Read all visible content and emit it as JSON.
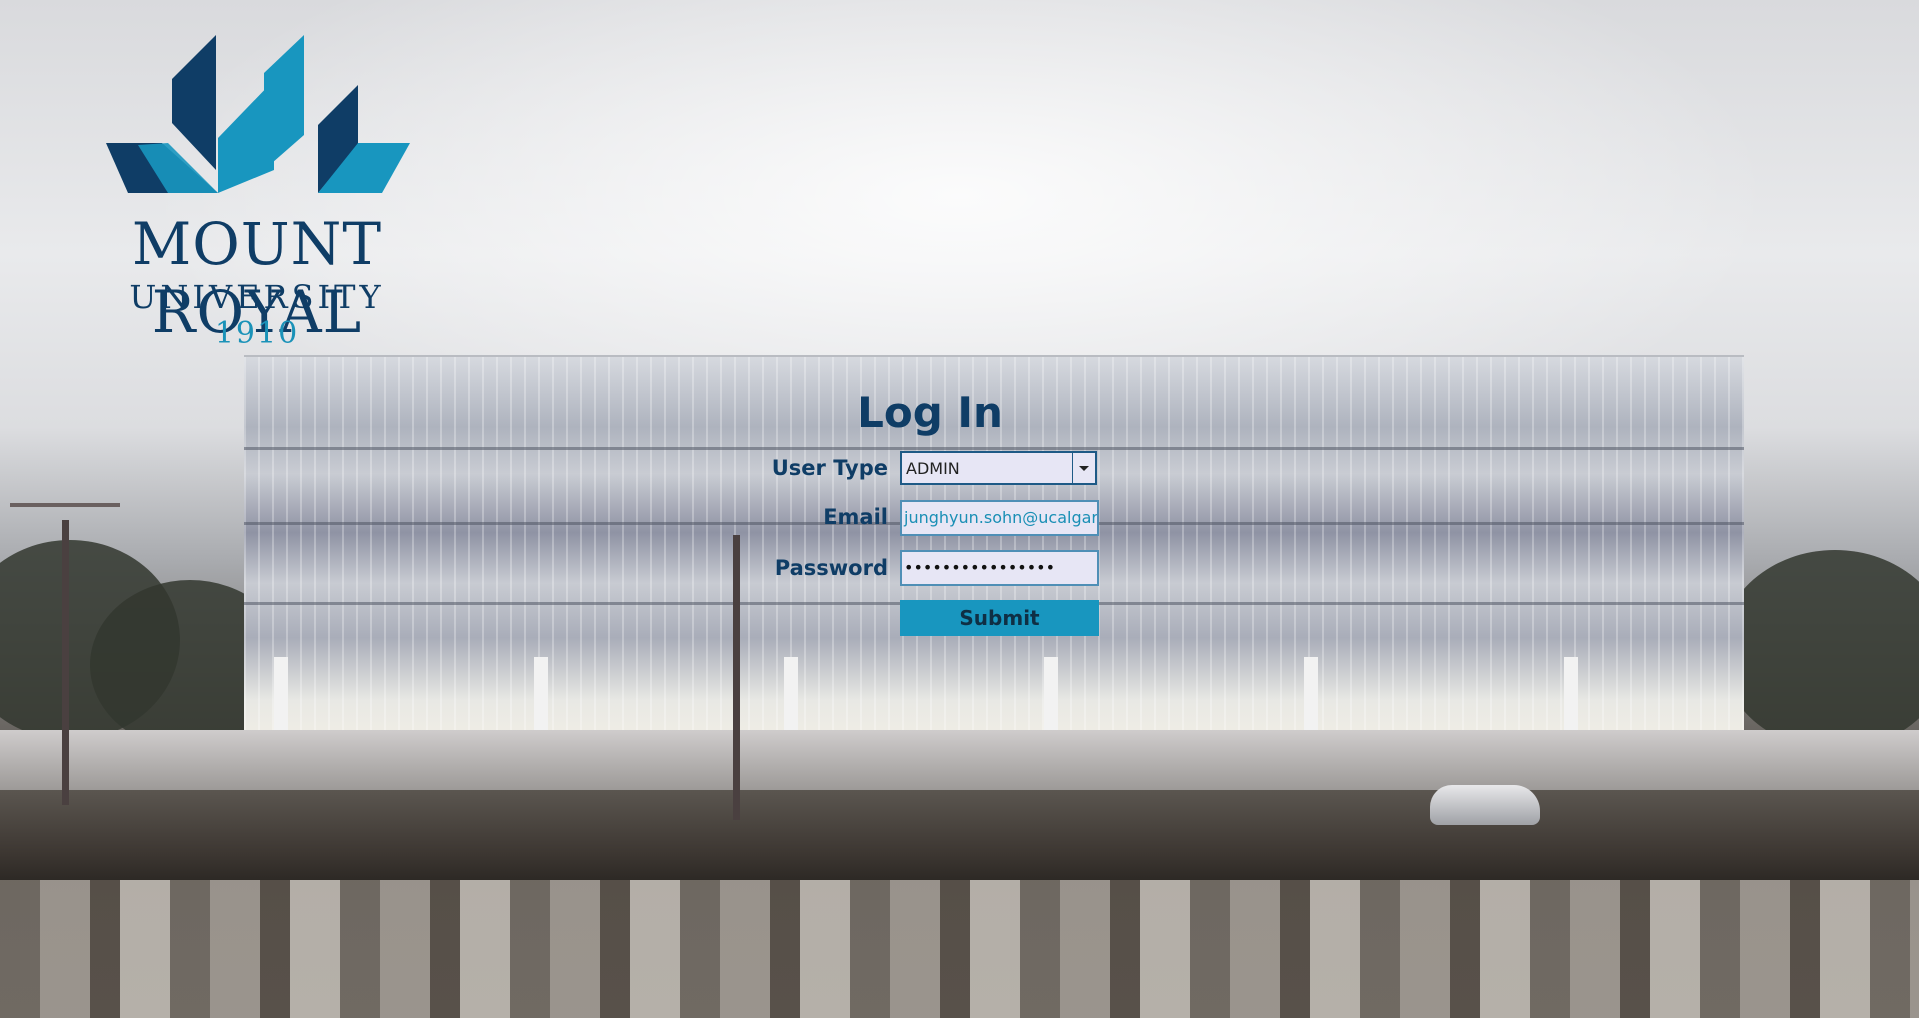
{
  "logo": {
    "title": "MOUNT ROYAL",
    "subtitle": "UNIVERSITY",
    "year": "1910",
    "colors": {
      "dark_blue": "#0f3d66",
      "light_blue": "#1a92b8"
    }
  },
  "login": {
    "title": "Log In",
    "user_type_label": "User Type",
    "user_type_value": "ADMIN",
    "email_label": "Email",
    "email_value": "junghyun.sohn@ucalgary",
    "password_label": "Password",
    "password_value": "••••••••••••••••",
    "submit_label": "Submit",
    "colors": {
      "submit_bg": "#1896bf",
      "field_bg": "#e7e6f5",
      "label": "#0f3d66"
    }
  }
}
